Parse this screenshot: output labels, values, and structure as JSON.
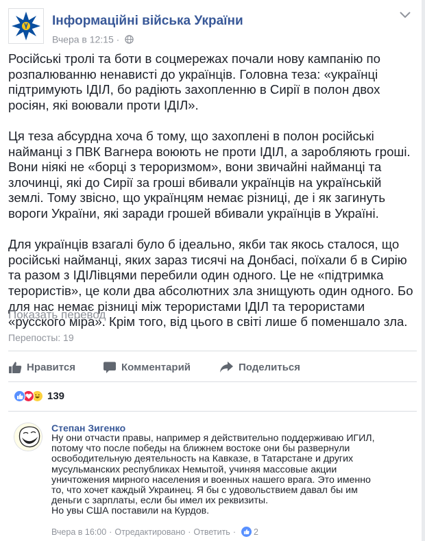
{
  "post": {
    "page_name": "Інформаційні війська України",
    "timestamp": "Вчера в 12:15",
    "meta_separator": "·",
    "paragraphs": [
      "Російські тролі та боти в соцмережах почали нову кампанію по розпалюванню ненависті до українців. Головна теза: «українці підтримують ІДІЛ, бо радіють захопленню в Сирії в полон двох росіян, які воювали проти ІДІЛ».",
      "Ця теза абсурдна хоча б тому, що захоплені в полон російські найманці з ПВК Вагнера воюють не проти ІДІЛ, а заробляють гроші. Вони ніякі не «борці з тероризмом», вони звичайні найманці та злочинці, які до Сирії за гроші вбивали українців на українській землі. Тому звісно, що українцям немає різниці, де і як загинуть вороги України, які заради грошей вбивали українців в Україні.",
      "Для українців взагалі було б ідеально, якби так якось сталося, що російські найманці, яких зараз тисячі на Донбасі, поїхали б в Сирію та разом з ІДІЛівцями перебили один одного. Це не «підтримка терористів», це коли два абсолютних зла знищують один одного. Бо для нас немає різниці між терористами ІДІЛ та терористами «русского міра». Крім того, від цього в світі лише б поменшало зла."
    ],
    "translate_link": "Показать перевод",
    "reposts": "Перепосты: 19"
  },
  "actions": {
    "like": "Нравится",
    "comment": "Комментарий",
    "share": "Поделиться"
  },
  "reactions": {
    "icons": [
      "like-icon",
      "love-icon",
      "haha-icon"
    ],
    "count": "139"
  },
  "comment": {
    "author": "Степан Зигенко",
    "lines": [
      "Ну они отчасти правы, например я действительно поддерживаю ИГИЛ,",
      "потому что после победы на ближнем востоке они бы развернули",
      "освободительную деятельность на Кавказе, в Татарстане и других",
      "мусульманских республиках Немытой, учиняя массовые акции",
      "уничтожения мирного населения и военных нашего врага. Это именно",
      "то, что хочет каждый Украинец. Я бы с удовольствием давал бы им",
      "деньги с зарплаты, если бы имел их реквизиты.",
      "Но увы США поставили на Курдов."
    ],
    "time": "Вчера в 16:00",
    "edited": "Отредактировано",
    "reply": "Ответить",
    "sep": "·",
    "like_count": "2"
  },
  "colors": {
    "link_blue": "#385898",
    "meta_gray": "#90949c",
    "action_gray": "#616770",
    "like_blue": "#5890ff",
    "love_red": "#f0284a",
    "haha_yellow": "#fcd13e"
  }
}
